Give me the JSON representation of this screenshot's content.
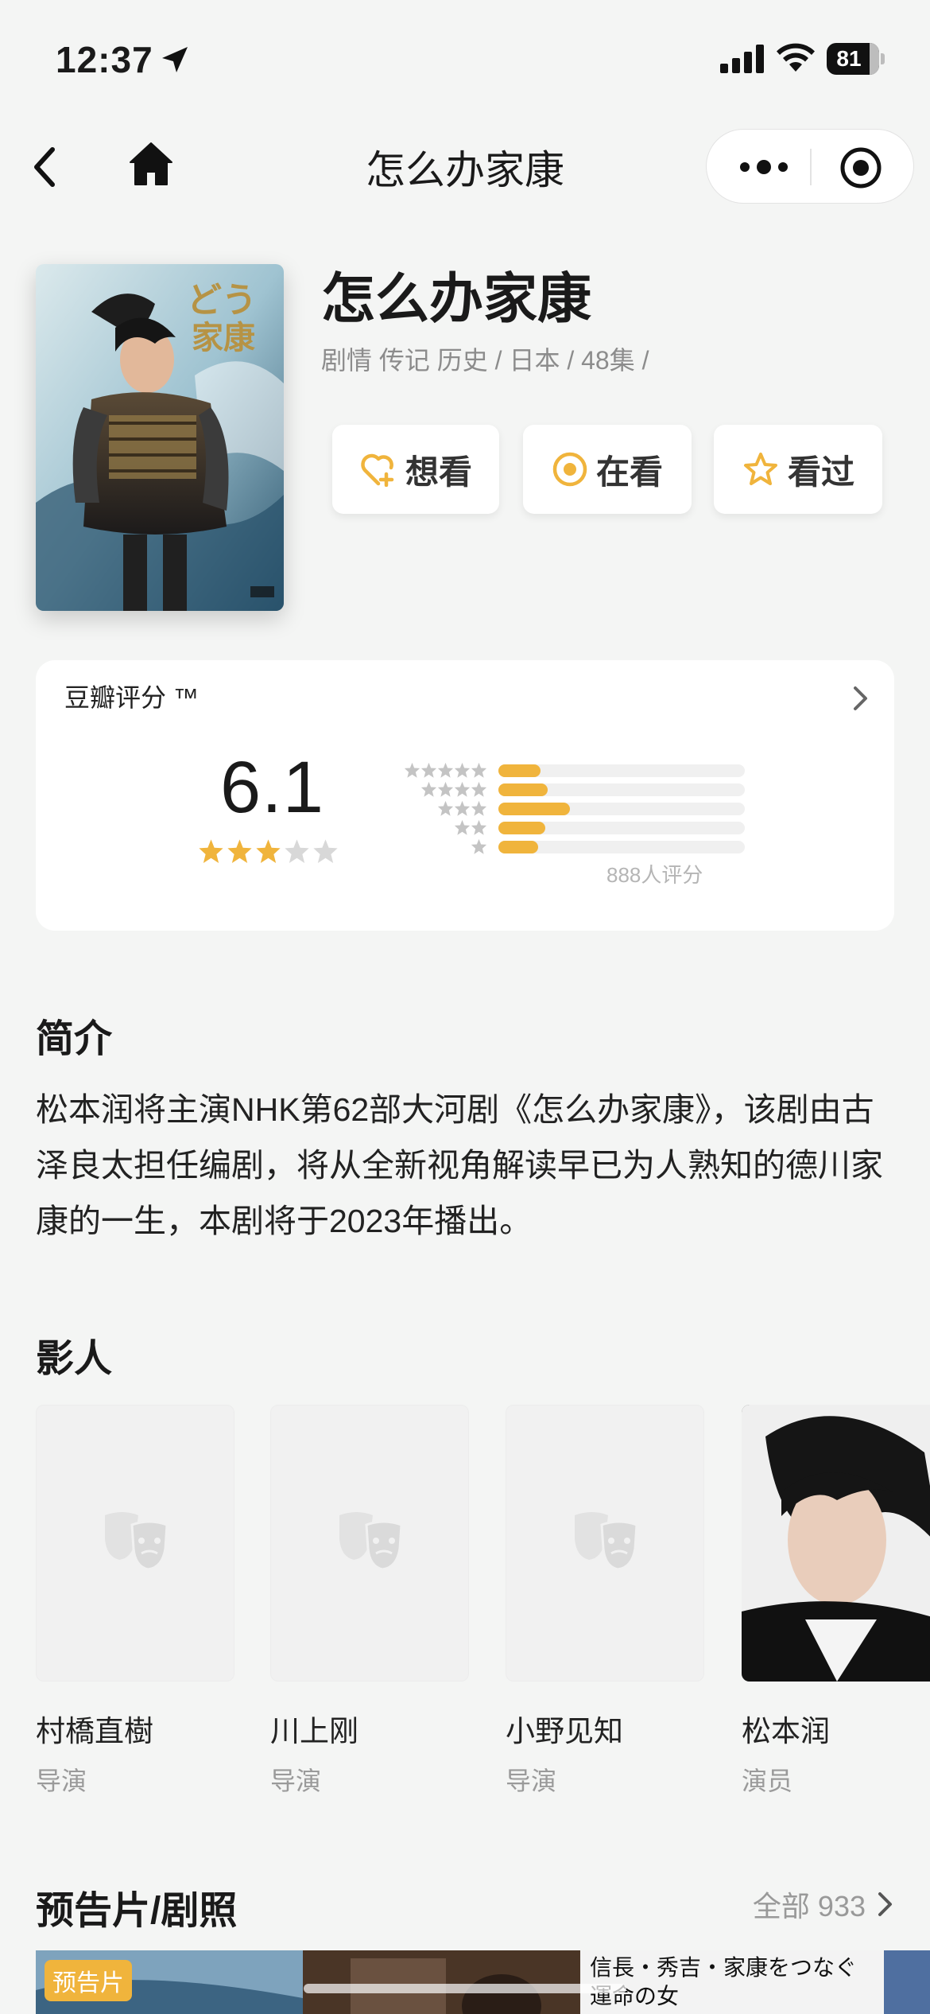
{
  "status_bar": {
    "time": "12:37",
    "battery": "81"
  },
  "nav": {
    "title": "怎么办家康"
  },
  "show": {
    "title": "怎么办家康",
    "meta": "剧情 传记 历史 / 日本 / 48集 /",
    "actions": {
      "want": "想看",
      "watching": "在看",
      "watched": "看过"
    }
  },
  "rating": {
    "label": "豆瓣评分 ™",
    "score": "6.1",
    "stars_filled": 3,
    "count_text": "888人评分",
    "distribution": [
      {
        "stars": 5,
        "fraction": 0.17
      },
      {
        "stars": 4,
        "fraction": 0.2
      },
      {
        "stars": 3,
        "fraction": 0.29
      },
      {
        "stars": 2,
        "fraction": 0.19
      },
      {
        "stars": 1,
        "fraction": 0.16
      }
    ],
    "colors": {
      "star": "#f0b43c",
      "star_empty": "#d8d8d8",
      "bar": "#f0b43c"
    }
  },
  "synopsis": {
    "heading": "简介",
    "text": "松本润将主演NHK第62部大河剧《怎么办家康》，该剧由古泽良太担任编剧，将从全新视角解读早已为人熟知的德川家康的一生，本剧将于2023年播出。"
  },
  "cast": {
    "heading": "影人",
    "members": [
      {
        "name": "村橋直樹",
        "role": "导演"
      },
      {
        "name": "川上刚",
        "role": "导演"
      },
      {
        "name": "小野见知",
        "role": "导演"
      },
      {
        "name": "松本润",
        "role": "演员"
      }
    ]
  },
  "media": {
    "heading": "预告片/剧照",
    "all_label": "全部 933",
    "trailer_badge": "预告片",
    "thumb_caption": "信長・秀吉・家康をつなぐ\n運命の女"
  }
}
